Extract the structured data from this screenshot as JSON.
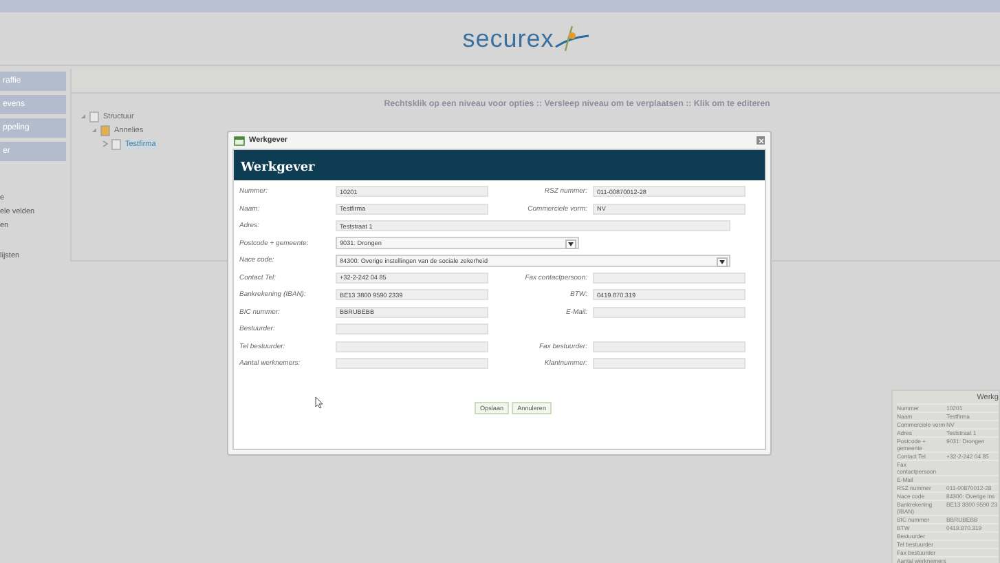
{
  "logo": {
    "text": "securex"
  },
  "sidebar": {
    "buttons": [
      {
        "label": "raffie"
      },
      {
        "label": "evens"
      },
      {
        "label": "ppeling"
      },
      {
        "label": "er"
      }
    ],
    "links": [
      {
        "label": "e"
      },
      {
        "label": "ele velden"
      },
      {
        "label": "en"
      },
      {
        "label": "lijsten"
      }
    ]
  },
  "main": {
    "instruction": "Rechtsklik op een niveau voor opties :: Versleep niveau om te verplaatsen :: Klik om te editeren",
    "tree": [
      {
        "label": "Structuur",
        "expanded": true,
        "selected": false,
        "children": [
          {
            "label": "Annelies",
            "expanded": true,
            "selected": false,
            "children": [
              {
                "label": "Testfirma",
                "expanded": false,
                "selected": true
              }
            ]
          }
        ]
      }
    ]
  },
  "dialog": {
    "title": "Werkgever",
    "heading": "Werkgever",
    "rows": [
      {
        "left": {
          "label": "Nummer:",
          "value": "10201",
          "kind": "text"
        },
        "right": {
          "label": "RSZ nummer:",
          "value": "011-00870012-28",
          "kind": "text"
        }
      },
      {
        "left": {
          "label": "Naam:",
          "value": "Testfirma",
          "kind": "text"
        },
        "right": {
          "label": "Commerciele vorm:",
          "value": "NV",
          "kind": "text"
        }
      },
      {
        "left": {
          "label": "Adres:",
          "value": "Teststraat 1",
          "kind": "wide"
        }
      },
      {
        "left": {
          "label": "Postcode + gemeente:",
          "value": "9031: Drongen",
          "kind": "select"
        }
      },
      {
        "left": {
          "label": "Nace code:",
          "value": "84300: Overige instellingen van de sociale zekerheid",
          "kind": "wideselect"
        }
      },
      {
        "left": {
          "label": "Contact Tel:",
          "value": "+32-2-242 04 85",
          "kind": "text"
        },
        "right": {
          "label": "Fax contactpersoon:",
          "kind": "text"
        }
      },
      {
        "left": {
          "label": "Bankrekening (IBAN):",
          "value": "BE13 3800 9590 2339",
          "kind": "text"
        },
        "right": {
          "label": "BTW:",
          "value": "0419.870.319",
          "kind": "text"
        }
      },
      {
        "left": {
          "label": "BIC nummer:",
          "value": "BBRUBEBB",
          "kind": "text"
        },
        "right": {
          "label": "E-Mail:",
          "kind": "text"
        }
      },
      {
        "left": {
          "label": "Bestuurder:",
          "kind": "text"
        }
      },
      {
        "left": {
          "label": "Tel bestuurder:",
          "kind": "text"
        },
        "right": {
          "label": "Fax bestuurder:",
          "kind": "text"
        }
      },
      {
        "left": {
          "label": "Aantal werknemers:",
          "kind": "text"
        },
        "right": {
          "label": "Klantnummer:",
          "kind": "text"
        }
      }
    ],
    "buttons": [
      {
        "label": "Opslaan"
      },
      {
        "label": "Annuleren"
      }
    ]
  },
  "summary": {
    "title": "Werkg",
    "rows": [
      {
        "label": "Nummer",
        "value": "10201"
      },
      {
        "label": "Naam",
        "value": "Testfirma"
      },
      {
        "label": "Commerciele vorm",
        "value": "NV"
      },
      {
        "label": "Adres",
        "value": "Teststraat 1"
      },
      {
        "label": "Postcode + gemeente",
        "value": "9031: Drongen"
      },
      {
        "label": "Contact Tel",
        "value": "+32-2-242 04 85"
      },
      {
        "label": "Fax contactpersoon"
      },
      {
        "label": "E-Mail"
      },
      {
        "label": "RSZ nummer",
        "value": "011-00870012-28"
      },
      {
        "label": "Nace code",
        "value": "84300: Overige ins"
      },
      {
        "label": "Bankrekening (IBAN)",
        "value": "BE13 3800 9590 23"
      },
      {
        "label": "BIC nummer",
        "value": "BBRUBEBB"
      },
      {
        "label": "BTW",
        "value": "0419.870.319"
      },
      {
        "label": "Bestuurder"
      },
      {
        "label": "Tel bestuurder"
      },
      {
        "label": "Fax bestuurder"
      },
      {
        "label": "Aantal werknemers"
      }
    ]
  }
}
